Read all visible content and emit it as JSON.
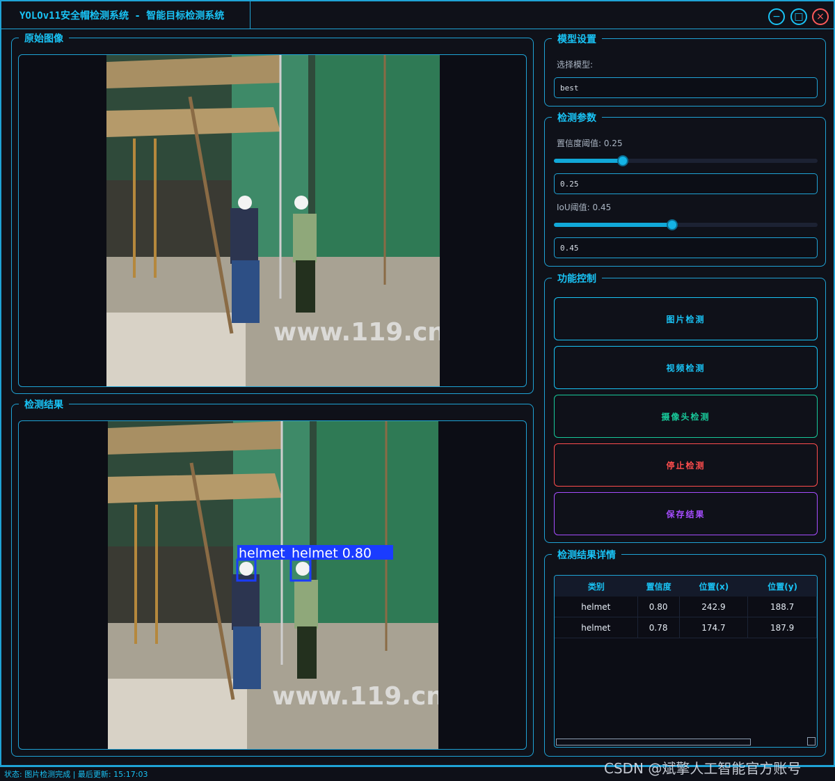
{
  "window": {
    "title": "YOLOv11安全帽检测系统 - 智能目标检测系统",
    "minimize_glyph": "−",
    "maximize_glyph": "□",
    "close_glyph": "×"
  },
  "original_panel": {
    "title": "原始图像",
    "image_content": "construction-site-photo"
  },
  "result_panel": {
    "title": "检测结果",
    "image_content": "construction-site-photo-with-boxes",
    "box_label_1": "helmet",
    "box_label_2": "helmet 0.80",
    "box_color": "#1a3cff"
  },
  "model_settings": {
    "title": "模型设置",
    "select_label": "选择模型:",
    "selected_model": "best"
  },
  "detection_params": {
    "title": "检测参数",
    "conf_label": "置信度阈值: 0.25",
    "conf_value": 0.25,
    "conf_input": "0.25",
    "iou_label": "IoU阈值: 0.45",
    "iou_value": 0.45,
    "iou_input": "0.45"
  },
  "controls": {
    "title": "功能控制",
    "buttons": [
      {
        "label": "图片检测",
        "color": "#19c3f5"
      },
      {
        "label": "视频检测",
        "color": "#19c3f5"
      },
      {
        "label": "摄像头检测",
        "color": "#18c99a"
      },
      {
        "label": "停止检测",
        "color": "#ff4d4d"
      },
      {
        "label": "保存结果",
        "color": "#a64dff"
      }
    ]
  },
  "details": {
    "title": "检测结果详情",
    "columns": [
      "类别",
      "置信度",
      "位置(x)",
      "位置(y)"
    ],
    "rows": [
      [
        "helmet",
        "0.80",
        "242.9",
        "188.7"
      ],
      [
        "helmet",
        "0.78",
        "174.7",
        "187.9"
      ]
    ]
  },
  "status": {
    "text": "状态: 图片检测完成 | 最后更新: 15:17:03"
  },
  "watermark": "CSDN @斌擎人工智能官方账号",
  "image_watermark": "www.119.cn"
}
